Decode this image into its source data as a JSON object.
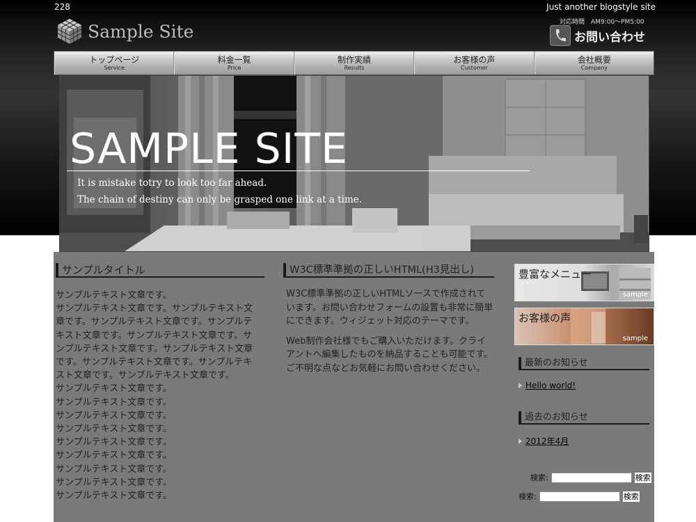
{
  "header": {
    "page_id": "228",
    "tagline": "Just another blogstyle site",
    "site_title": "Sample Site",
    "hours": "対応時間　AM9:00〜PM5:00",
    "contact_label": "お問い合わせ"
  },
  "nav": [
    {
      "jp": "トップページ",
      "en": "Service"
    },
    {
      "jp": "料金一覧",
      "en": "Price"
    },
    {
      "jp": "制作実績",
      "en": "Results"
    },
    {
      "jp": "お客様の声",
      "en": "Customer"
    },
    {
      "jp": "会社概要",
      "en": "Company"
    }
  ],
  "hero": {
    "title": "SAMPLE SITE",
    "line1": "It is mistake totry to look too far ahead.",
    "line2": "The chain of destiny can only be grasped one link at a time."
  },
  "col1": {
    "title": "サンプルタイトル",
    "text": [
      "サンプルテキスト文章です。",
      "サンプルテキスト文章です。サンプルテキスト文",
      "章です。サンプルテキスト文章です。サンプルテ",
      "キスト文章です。サンプルテキスト文章です。サ",
      "ンプルテキスト文章です。サンプルテキスト文章",
      "です。サンプルテキスト文章です。サンプルテキ",
      "スト文章です。サンプルテキスト文章です。",
      "サンプルテキスト文章です。",
      "サンプルテキスト文章です。",
      "サンプルテキスト文章です。",
      "サンプルテキスト文章です。",
      "サンプルテキスト文章です。",
      "サンプルテキスト文章です。",
      "サンプルテキスト文章です。",
      "サンプルテキスト文章です。",
      "サンプルテキスト文章です。"
    ]
  },
  "col2": {
    "title": "W3C標準準拠の正しいHTML(H3見出し)",
    "p1": "W3C標準準拠の正しいHTMLソースで作成されています。お問い合わせフォームの設置も非常に簡単にできます。ウィジェット対応のテーマです。",
    "p2": "Web制作会社様でもご購入いただけます。クライアントへ編集したものを納品することも可能です。ご不明な点などお気軽にお問い合わせください。"
  },
  "sidebar": {
    "banner1_title": "豊富なメニュー",
    "banner2_title": "お客様の声",
    "banner_sample": "sample",
    "news_title": "最新のお知らせ",
    "news_item": "Hello world!",
    "archive_title": "過去のお知らせ",
    "archive_item": "2012年4月"
  },
  "search": {
    "label": "検索:",
    "button": "検索"
  }
}
